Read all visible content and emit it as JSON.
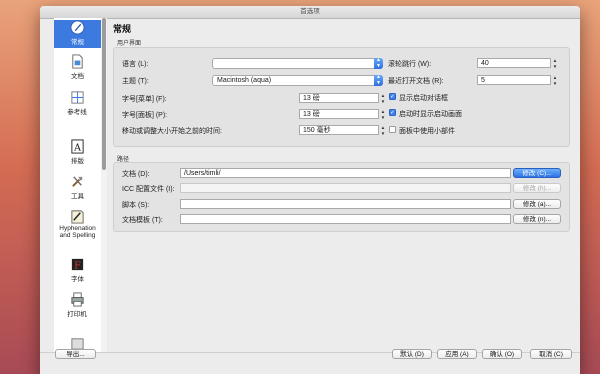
{
  "window": {
    "title": "首选项"
  },
  "sidebar": {
    "items": [
      {
        "label": "常规",
        "icon": "general-icon"
      },
      {
        "label": "文档",
        "icon": "document-icon"
      },
      {
        "label": "参考线",
        "icon": "guides-icon"
      },
      {
        "label": "排版",
        "icon": "type-icon"
      },
      {
        "label": "工具",
        "icon": "tools-icon"
      },
      {
        "label": "Hyphenation and Spelling",
        "icon": "hyphenation-icon"
      },
      {
        "label": "字体",
        "icon": "fonts-icon"
      },
      {
        "label": "打印机",
        "icon": "printer-icon"
      }
    ]
  },
  "header": {
    "title": "常规"
  },
  "ui_group": {
    "title": "用户界面",
    "language_label": "语言 (L):",
    "language_value": "",
    "theme_label": "主题 (T):",
    "theme_value": "Macintosh (aqua)",
    "menu_font_label": "字号[菜单] (F):",
    "menu_font_value": "13 磅",
    "palette_font_label": "字号[面板] (P):",
    "palette_font_value": "13 磅",
    "resize_label": "移动或调整大小开始之前的时间:",
    "resize_value": "150 毫秒",
    "wheel_label": "滚轮跳行 (W):",
    "wheel_value": "40",
    "recent_label": "最近打开文档 (R):",
    "recent_value": "5",
    "chk_startup_dialog": "显示启动对话框",
    "chk_splash": "启动时显示启动画面",
    "chk_widgets": "面板中使用小部件"
  },
  "paths_group": {
    "title": "路径",
    "rows": [
      {
        "label": "文档 (D):",
        "value": "/Users/timli/",
        "button": "修改 (C)..."
      },
      {
        "label": "ICC 配置文件 (I):",
        "value": "",
        "button": "修改 (h)..."
      },
      {
        "label": "脚本 (S):",
        "value": "",
        "button": "修改 (a)..."
      },
      {
        "label": "文档模板 (T):",
        "value": "",
        "button": "修改 (n)..."
      }
    ]
  },
  "footer": {
    "export": "导出...",
    "defaults": "默认 (D)",
    "apply": "应用 (A)",
    "ok": "确认 (O)",
    "cancel": "取消 (C)"
  },
  "colors": {
    "accent": "#3d7ae0",
    "dialog_bg": "#ececec"
  }
}
